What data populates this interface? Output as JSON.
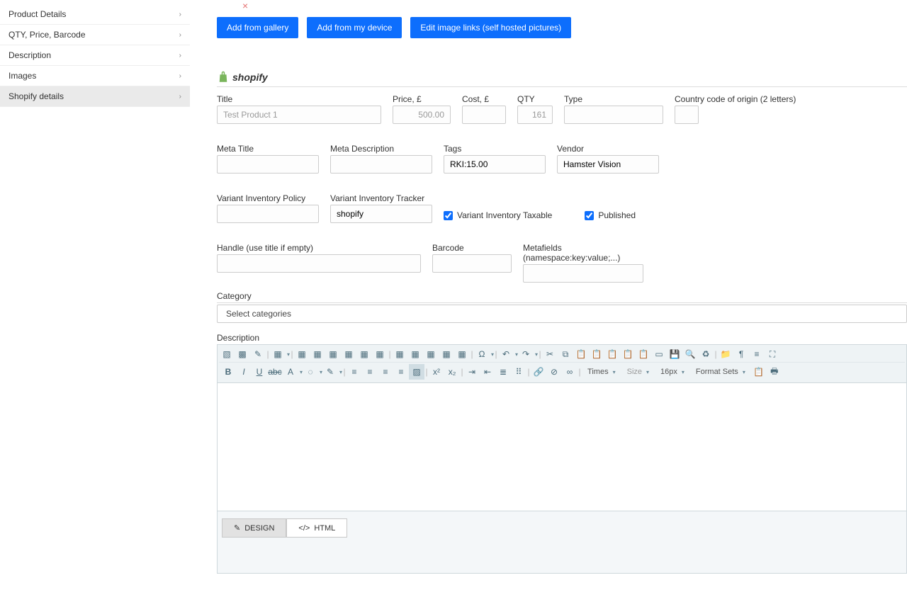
{
  "sidebar": {
    "items": [
      {
        "label": "Product Details",
        "active": false
      },
      {
        "label": "QTY, Price, Barcode",
        "active": false
      },
      {
        "label": "Description",
        "active": false
      },
      {
        "label": "Images",
        "active": false
      },
      {
        "label": "Shopify details",
        "active": true
      }
    ]
  },
  "buttons": {
    "add_gallery": "Add from gallery",
    "add_device": "Add from my device",
    "edit_links": "Edit image links (self hosted pictures)"
  },
  "shopify": {
    "brand": "shopify",
    "labels": {
      "title": "Title",
      "price": "Price, £",
      "cost": "Cost, £",
      "qty": "QTY",
      "type": "Type",
      "country": "Country code of origin (2 letters)",
      "meta_title": "Meta Title",
      "meta_desc": "Meta Description",
      "tags": "Tags",
      "vendor": "Vendor",
      "vip": "Variant Inventory Policy",
      "vit": "Variant Inventory Tracker",
      "vtax": "Variant Inventory Taxable",
      "published": "Published",
      "handle": "Handle (use title if empty)",
      "barcode": "Barcode",
      "metafields": "Metafields (namespace:key:value;...)",
      "category": "Category",
      "select_cat": "Select categories",
      "description": "Description"
    },
    "values": {
      "title": "Test Product 1",
      "price": "500.00",
      "cost": "",
      "qty": "161",
      "type": "",
      "country": "",
      "meta_title": "",
      "meta_desc": "",
      "tags": "RKI:15.00",
      "vendor": "Hamster Vision",
      "vip": "",
      "vit": "shopify",
      "handle": "",
      "barcode": "",
      "metafields": ""
    }
  },
  "editor": {
    "font": "Times",
    "size_label": "Size",
    "size_value": "16px",
    "format_sets": "Format Sets",
    "tabs": {
      "design": "DESIGN",
      "html": "HTML"
    }
  }
}
